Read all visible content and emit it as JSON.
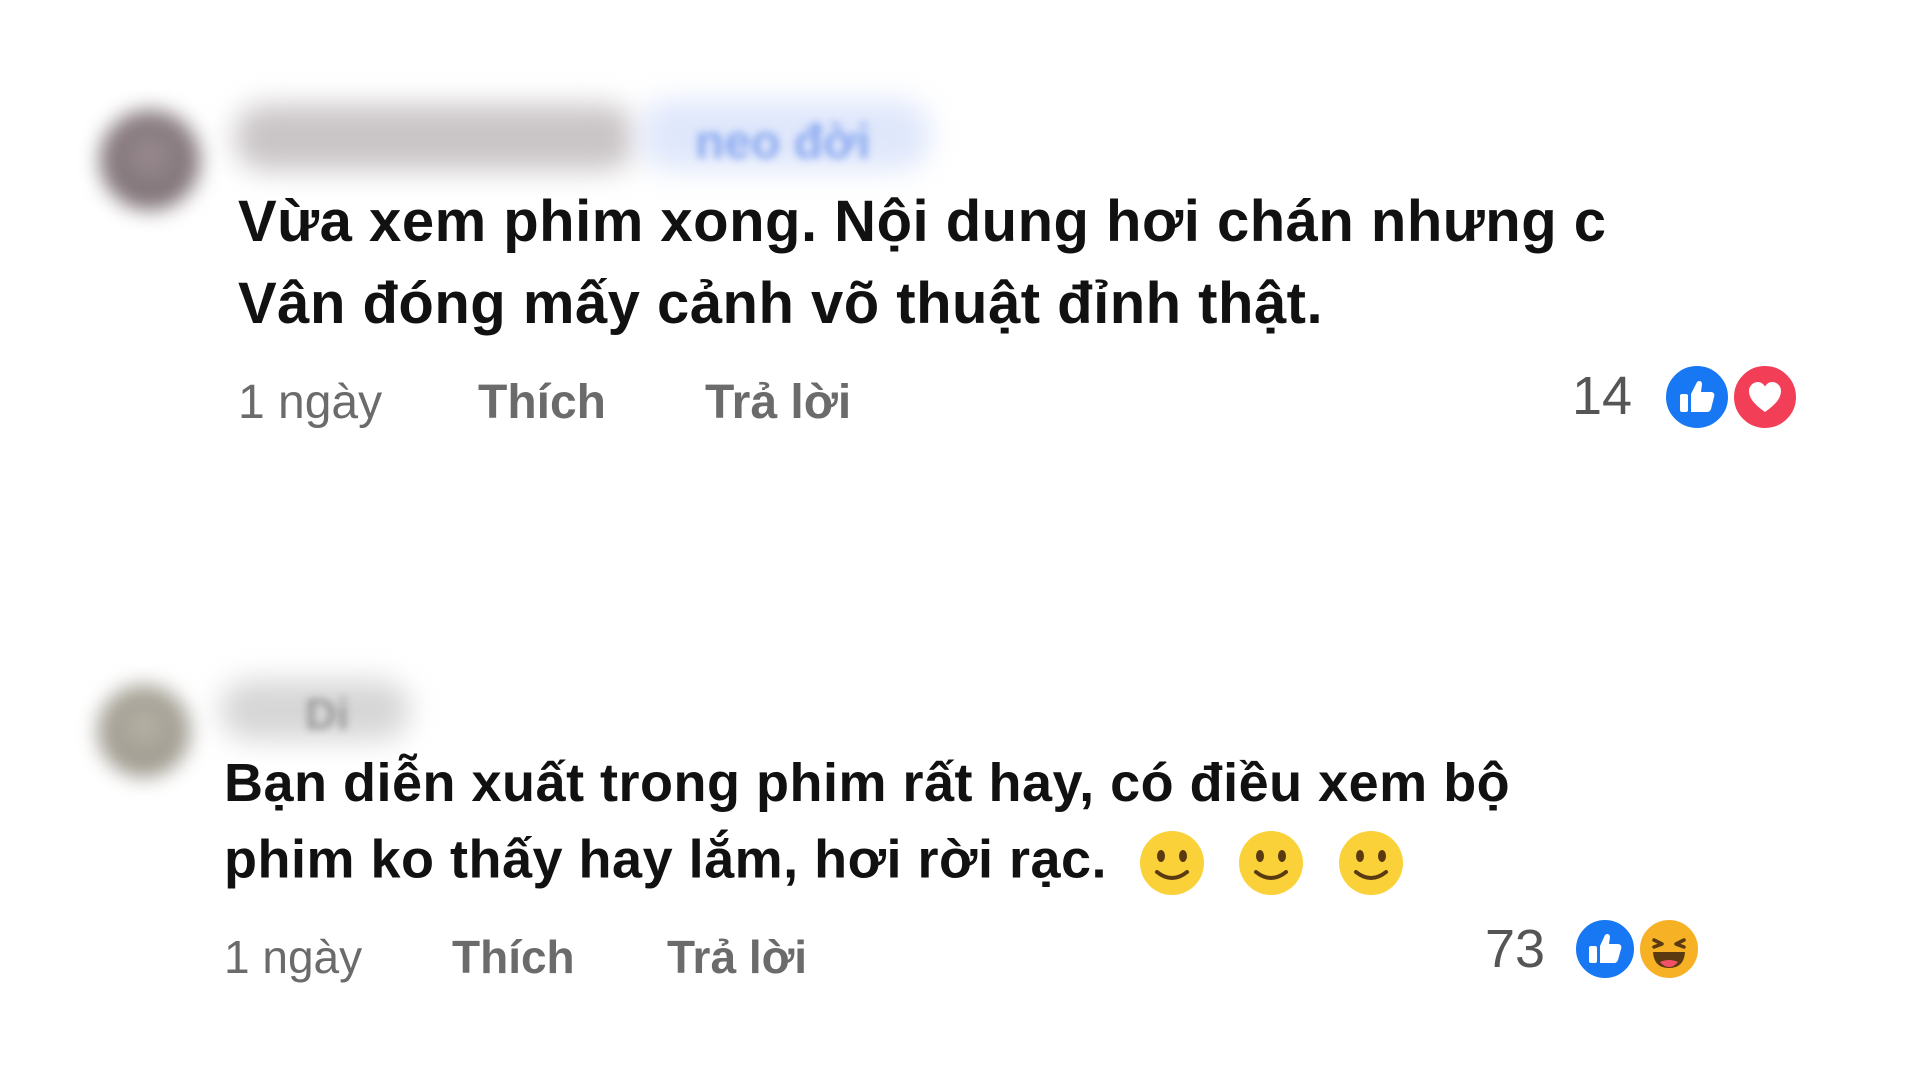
{
  "comments": [
    {
      "author_visible": "neo đời",
      "text_line1": "Vừa xem phim xong. Nội dung hơi chán nhưng c",
      "text_line2": "Vân đóng mấy cảnh võ thuật đỉnh thật.",
      "time": "1 ngày",
      "like_label": "Thích",
      "reply_label": "Trả lời",
      "reaction_count": "14",
      "reactions": [
        "like-icon",
        "love-icon"
      ],
      "colors": {
        "like": "#1877f2",
        "love": "#f33e58"
      }
    },
    {
      "author_visible": "Di",
      "text_line1": "Bạn diễn xuất trong phim rất hay, có điều xem bộ",
      "text_line2": "phim ko thấy hay lắm, hơi rời rạc.",
      "emojis": [
        "smiley-icon",
        "smiley-icon",
        "smiley-icon"
      ],
      "time": "1 ngày",
      "like_label": "Thích",
      "reply_label": "Trả lời",
      "reaction_count": "73",
      "reactions": [
        "like-icon",
        "haha-icon"
      ],
      "colors": {
        "like": "#1877f2",
        "haha": "#f7b125"
      }
    }
  ]
}
